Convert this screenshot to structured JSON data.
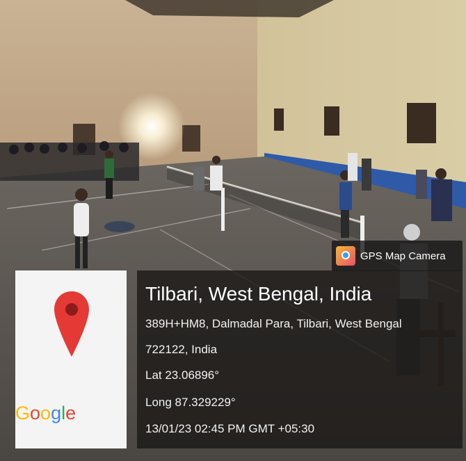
{
  "overlay": {
    "app_name": "GPS Map Camera",
    "map_logo": "Google",
    "location_title": "Tilbari, West Bengal, India",
    "address_line1": "389H+HM8, Dalmadal Para, Tilbari, West Bengal",
    "address_line2": "722122, India",
    "latitude": "Lat 23.06896°",
    "longitude": "Long 87.329229°",
    "timestamp": "13/01/23 02:45 PM GMT +05:30"
  },
  "icons": {
    "app": "camera-map-icon",
    "map_pin": "map-pin-icon"
  },
  "colors": {
    "pin_red": "#e53935",
    "google_blue": "#4285f4",
    "google_red": "#ea4335",
    "google_yellow": "#fbbc05",
    "google_green": "#34a853"
  }
}
